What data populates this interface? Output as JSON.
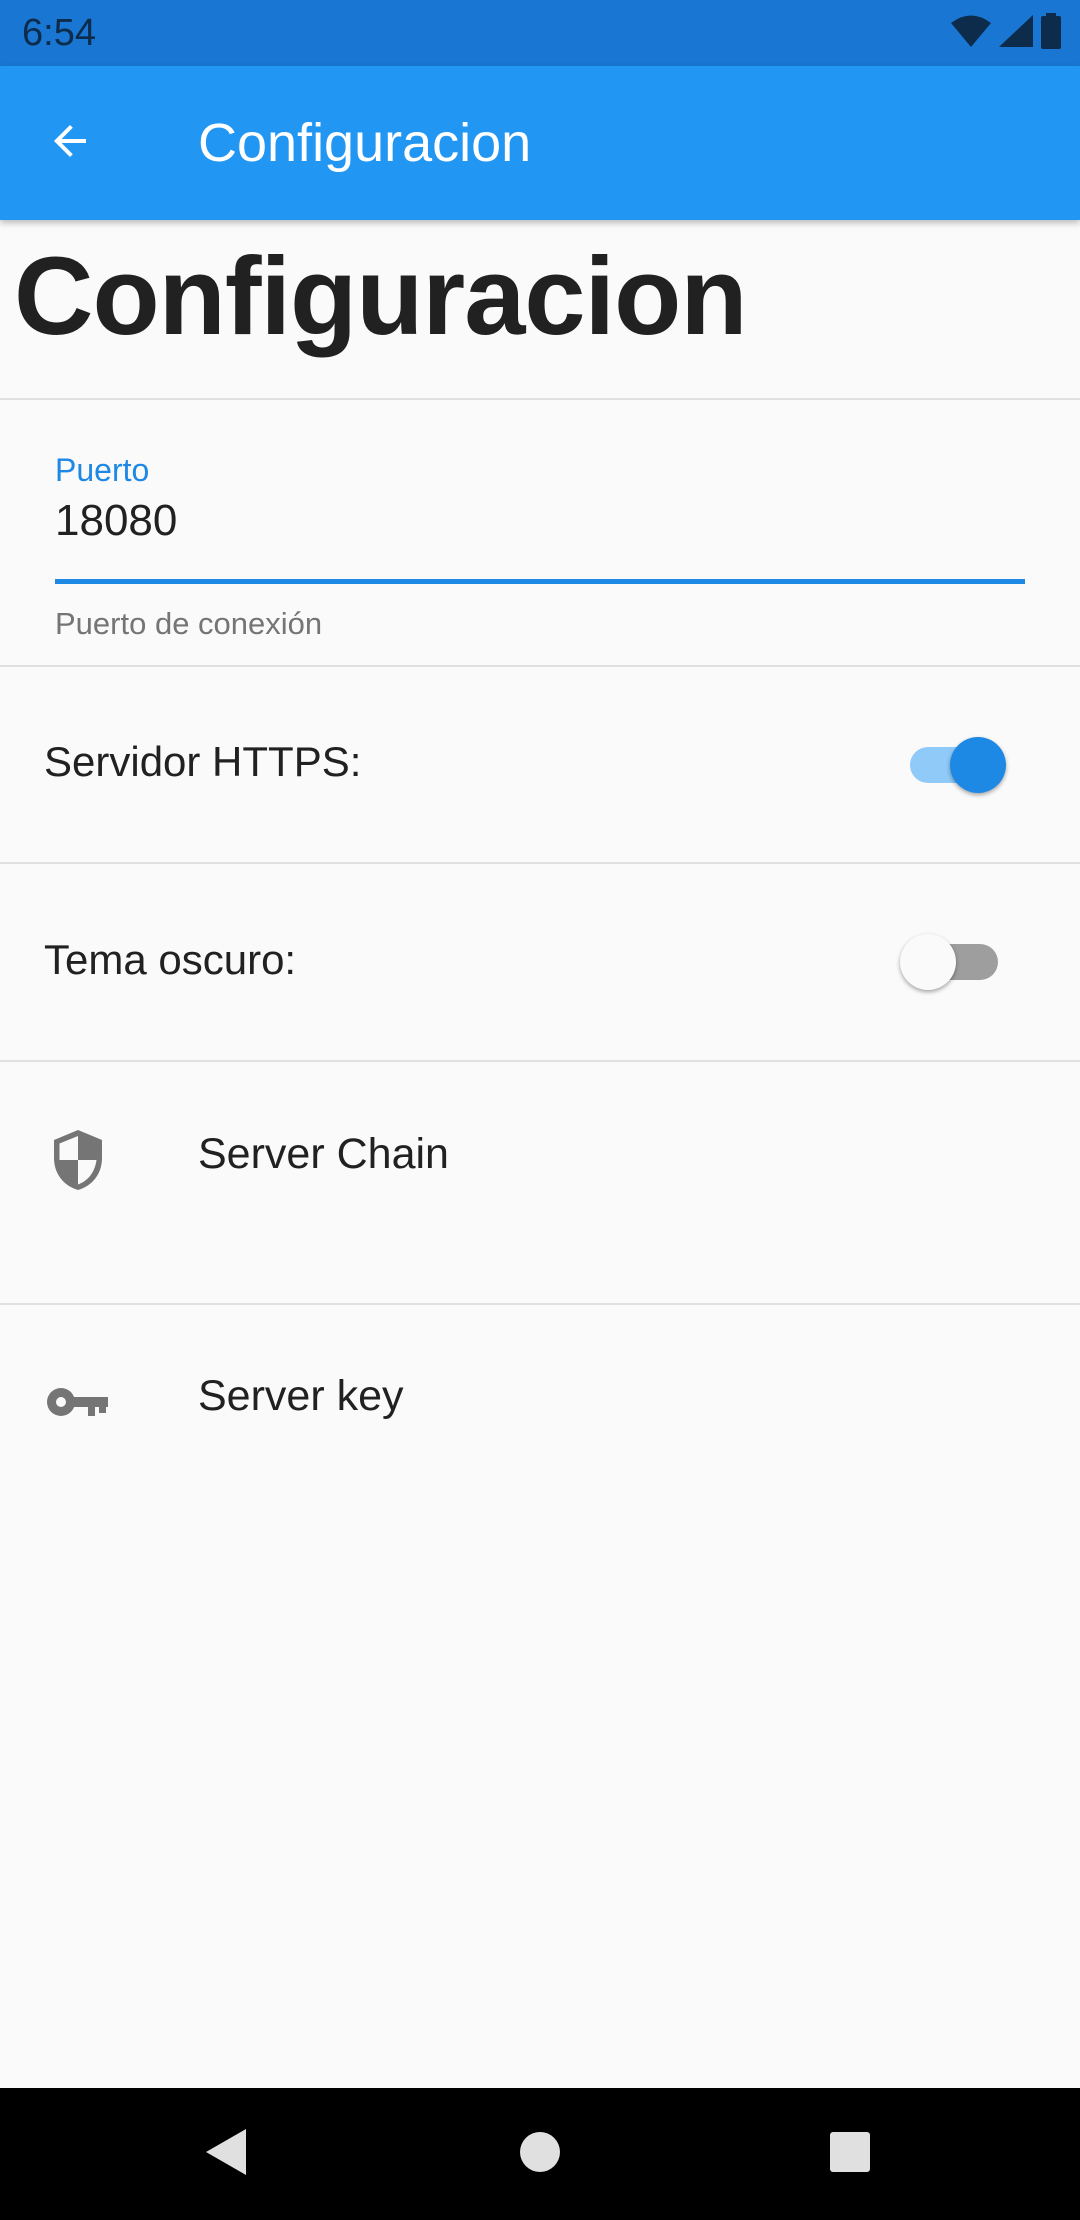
{
  "status_bar": {
    "time": "6:54",
    "icons": [
      "wifi-icon",
      "signal-icon",
      "battery-icon"
    ],
    "color": "#1976d2"
  },
  "app_bar": {
    "title": "Configuracion",
    "back_icon": "arrow-back-icon",
    "color": "#2196f3"
  },
  "page": {
    "heading": "Configuracion"
  },
  "port_field": {
    "label": "Puerto",
    "value": "18080",
    "helper": "Puerto de conexión",
    "accent": "#1e88e5"
  },
  "settings": {
    "https": {
      "label": "Servidor HTTPS:",
      "enabled": true
    },
    "dark_theme": {
      "label": "Tema oscuro:",
      "enabled": false
    }
  },
  "list_items": [
    {
      "icon": "shield-icon",
      "label": "Server Chain"
    },
    {
      "icon": "key-icon",
      "label": "Server key"
    }
  ],
  "nav_bar": {
    "buttons": [
      "back-triangle-icon",
      "home-circle-icon",
      "recents-square-icon"
    ]
  }
}
